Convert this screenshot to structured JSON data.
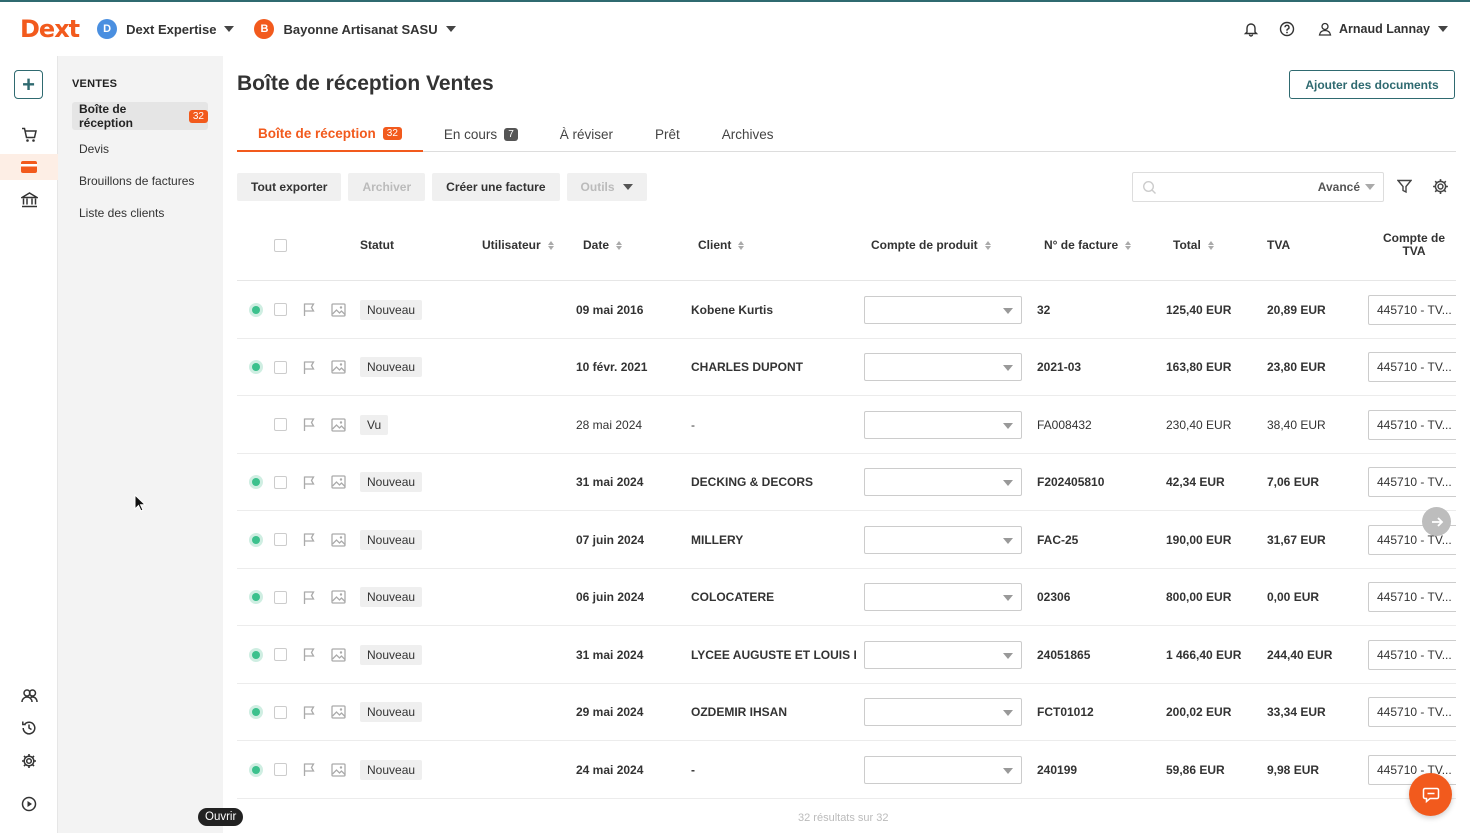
{
  "header": {
    "logo": "Dext",
    "org1": {
      "initial": "D",
      "name": "Dext Expertise",
      "color": "#4a8fe0"
    },
    "org2": {
      "initial": "B",
      "name": "Bayonne Artisanat SASU",
      "color": "#f25a1d"
    },
    "user": "Arnaud Lannay"
  },
  "subnav": {
    "section": "VENTES",
    "items": [
      {
        "label": "Boîte de réception",
        "count": "32"
      },
      {
        "label": "Devis"
      },
      {
        "label": "Brouillons de factures"
      },
      {
        "label": "Liste des clients"
      }
    ]
  },
  "main": {
    "title": "Boîte de réception Ventes",
    "add_docs": "Ajouter des documents",
    "tabs": [
      {
        "label": "Boîte de réception",
        "count": "32"
      },
      {
        "label": "En cours",
        "count": "7"
      },
      {
        "label": "À réviser"
      },
      {
        "label": "Prêt"
      },
      {
        "label": "Archives"
      }
    ],
    "toolbar": {
      "export": "Tout exporter",
      "archive": "Archiver",
      "create": "Créer une facture",
      "tools": "Outils"
    },
    "search": {
      "placeholder": "",
      "advanced": "Avancé"
    },
    "columns": {
      "status": "Statut",
      "user": "Utilisateur",
      "date": "Date",
      "client": "Client",
      "product_account": "Compte de produit",
      "invoice_no": "N° de facture",
      "total": "Total",
      "tva": "TVA",
      "tva_account_1": "Compte de",
      "tva_account_2": "TVA"
    },
    "rows": [
      {
        "new": true,
        "status": "Nouveau",
        "date": "09 mai 2016",
        "client": "Kobene Kurtis",
        "invoice": "32",
        "total": "125,40 EUR",
        "tva": "20,89 EUR",
        "tva_account": "445710 - TV..."
      },
      {
        "new": true,
        "status": "Nouveau",
        "date": "10 févr. 2021",
        "client": "CHARLES DUPONT",
        "invoice": "2021-03",
        "total": "163,80 EUR",
        "tva": "23,80 EUR",
        "tva_account": "445710 - TV..."
      },
      {
        "new": false,
        "status": "Vu",
        "date": "28 mai 2024",
        "client": "-",
        "invoice": "FA008432",
        "total": "230,40 EUR",
        "tva": "38,40 EUR",
        "tva_account": "445710 - TV..."
      },
      {
        "new": true,
        "status": "Nouveau",
        "date": "31 mai 2024",
        "client": "DECKING & DECORS",
        "invoice": "F202405810",
        "total": "42,34 EUR",
        "tva": "7,06 EUR",
        "tva_account": "445710 - TV..."
      },
      {
        "new": true,
        "status": "Nouveau",
        "date": "07 juin 2024",
        "client": "MILLERY",
        "invoice": "FAC-25",
        "total": "190,00 EUR",
        "tva": "31,67 EUR",
        "tva_account": "445710 - TV..."
      },
      {
        "new": true,
        "status": "Nouveau",
        "date": "06 juin 2024",
        "client": "COLOCATERE",
        "invoice": "02306",
        "total": "800,00 EUR",
        "tva": "0,00 EUR",
        "tva_account": "445710 - TV..."
      },
      {
        "new": true,
        "status": "Nouveau",
        "date": "31 mai 2024",
        "client": "LYCEE AUGUSTE ET LOUIS L...",
        "invoice": "24051865",
        "total": "1 466,40 EUR",
        "tva": "244,40 EUR",
        "tva_account": "445710 - TV..."
      },
      {
        "new": true,
        "status": "Nouveau",
        "date": "29 mai 2024",
        "client": "OZDEMIR IHSAN",
        "invoice": "FCT01012",
        "total": "200,02 EUR",
        "tva": "33,34 EUR",
        "tva_account": "445710 - TV..."
      },
      {
        "new": true,
        "status": "Nouveau",
        "date": "24 mai 2024",
        "client": "-",
        "invoice": "240199",
        "total": "59,86 EUR",
        "tva": "9,98 EUR",
        "tva_account": "445710 - TV..."
      }
    ],
    "footer": "32 résultats sur 32"
  },
  "tooltip": "Ouvrir",
  "colors": {
    "accent": "#f25a1d",
    "brand": "#2f6a70",
    "success": "#3cc18d"
  }
}
